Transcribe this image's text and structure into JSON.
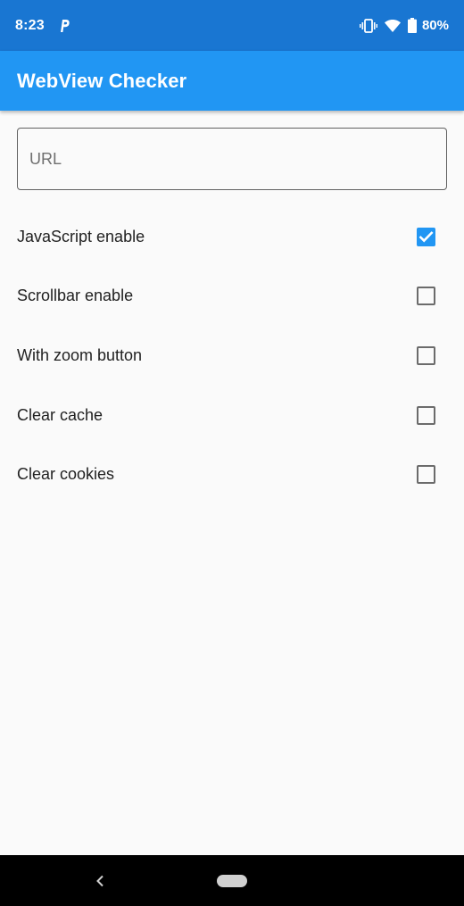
{
  "status_bar": {
    "time": "8:23",
    "battery_percent": "80%",
    "icons": [
      "parking-icon",
      "vibrate-icon",
      "wifi-icon",
      "battery-icon"
    ]
  },
  "app_bar": {
    "title": "WebView Checker",
    "color": "#2196f3",
    "status_color": "#1976d2"
  },
  "url_field": {
    "placeholder": "URL",
    "value": ""
  },
  "options": [
    {
      "label": "JavaScript enable",
      "checked": true
    },
    {
      "label": "Scrollbar enable",
      "checked": false
    },
    {
      "label": "With zoom button",
      "checked": false
    },
    {
      "label": "Clear cache",
      "checked": false
    },
    {
      "label": "Clear cookies",
      "checked": false
    }
  ],
  "navigation": {
    "icons": [
      "back-icon",
      "home-pill-icon"
    ]
  }
}
